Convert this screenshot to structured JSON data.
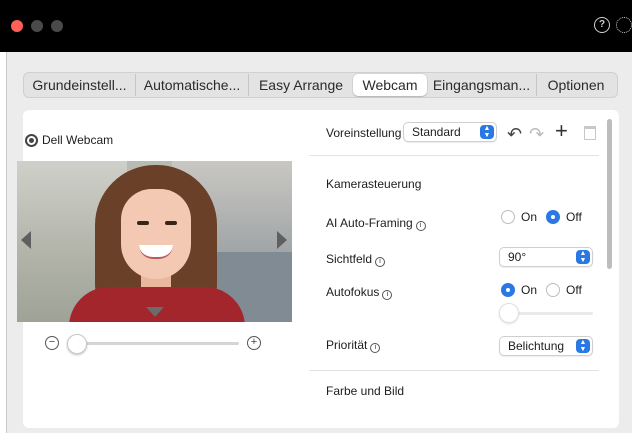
{
  "titlebar": {
    "icons": [
      "help-icon",
      "gear-icon"
    ]
  },
  "tabs": [
    {
      "label": "Grundeinstell...",
      "active": false
    },
    {
      "label": "Automatische...",
      "active": false
    },
    {
      "label": "Easy Arrange",
      "active": false
    },
    {
      "label": "Webcam",
      "active": true
    },
    {
      "label": "Eingangsman...",
      "active": false
    },
    {
      "label": "Optionen",
      "active": false
    }
  ],
  "camera": {
    "name": "Dell Webcam",
    "zoom_level": 0
  },
  "preset": {
    "label": "Voreinstellung",
    "value": "Standard"
  },
  "camera_control": {
    "heading": "Kamerasteuerung",
    "ai_framing": {
      "label": "AI Auto-Framing",
      "on_label": "On",
      "off_label": "Off",
      "selected": "Off"
    },
    "field_of_view": {
      "label": "Sichtfeld",
      "value": "90°"
    },
    "autofocus": {
      "label": "Autofokus",
      "on_label": "On",
      "off_label": "Off",
      "selected": "On",
      "focus_level": 0
    },
    "priority": {
      "label": "Priorität",
      "value": "Belichtung"
    }
  },
  "color_image": {
    "heading": "Farbe und Bild"
  },
  "colors": {
    "accent": "#2a78e4",
    "titlebar": "#000000",
    "close": "#fe5f57"
  }
}
